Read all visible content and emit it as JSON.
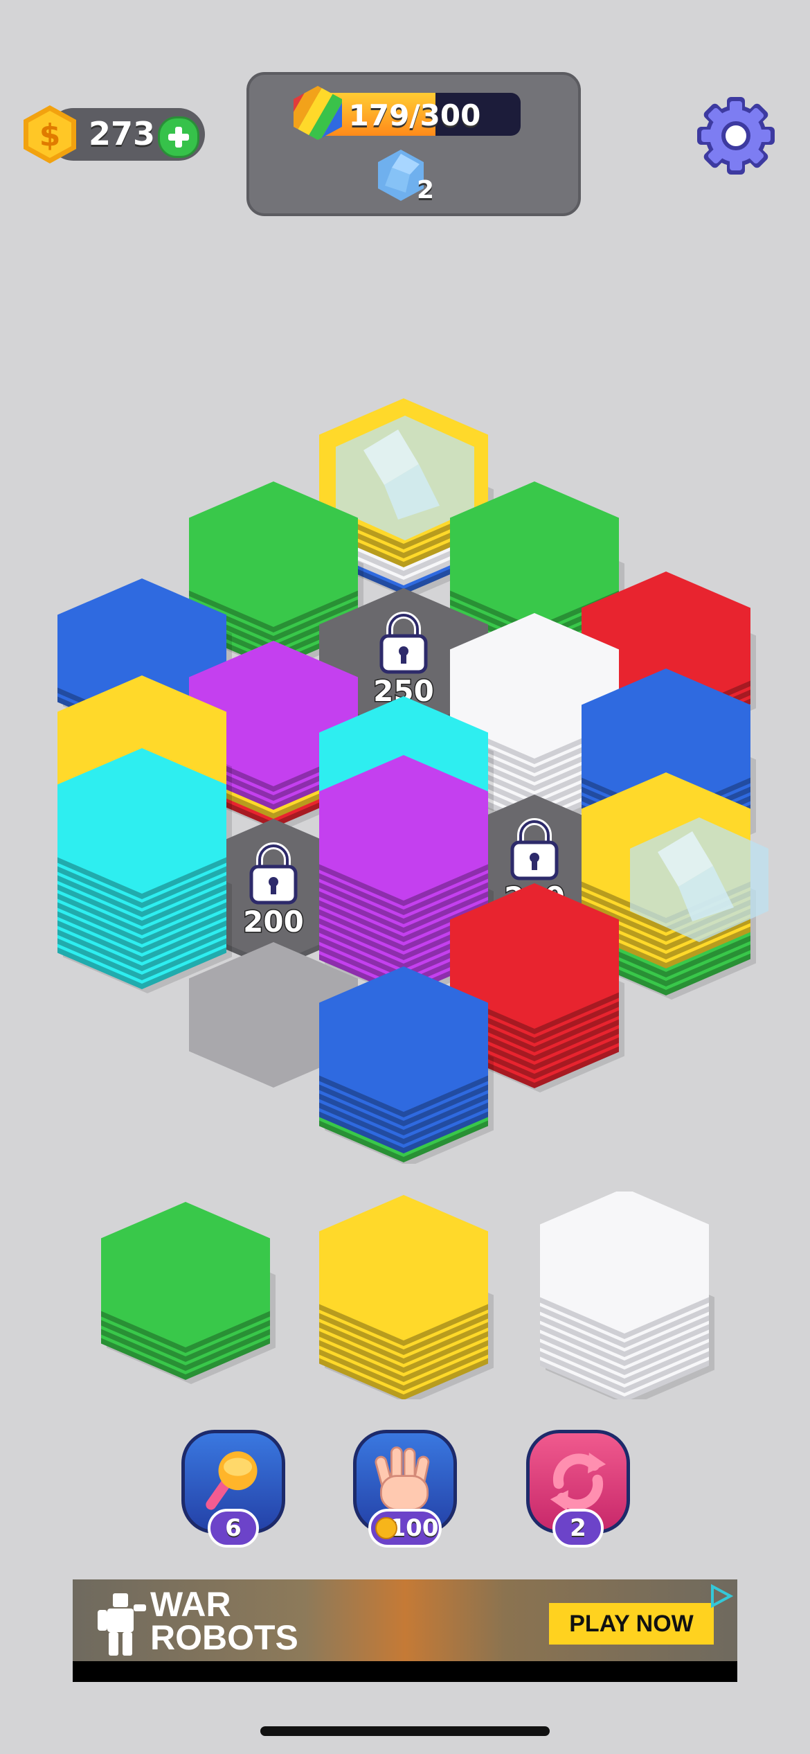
{
  "topbar": {
    "coins": "273",
    "progress_text": "179/300",
    "progress_fraction": 0.597,
    "crystal_count": "2"
  },
  "board": {
    "locks": [
      {
        "cost": "250"
      },
      {
        "cost": "200"
      },
      {
        "cost": "200"
      }
    ]
  },
  "tray": {
    "stacks": [
      "green",
      "yellow",
      "white"
    ]
  },
  "boosters": {
    "hammer_count": "6",
    "hand_cost": "100",
    "shuffle_count": "2"
  },
  "ad": {
    "brand_line1": "WAR",
    "brand_line2": "ROBOTS",
    "cta": "PLAY NOW"
  },
  "colors": {
    "green": "#39c84a",
    "blue": "#2f6ae0",
    "red": "#e8242f",
    "yellow": "#ffd92a",
    "purple": "#c440ef",
    "cyan": "#2eeef0",
    "white": "#ffffff",
    "gray": "#a9a8ac"
  }
}
